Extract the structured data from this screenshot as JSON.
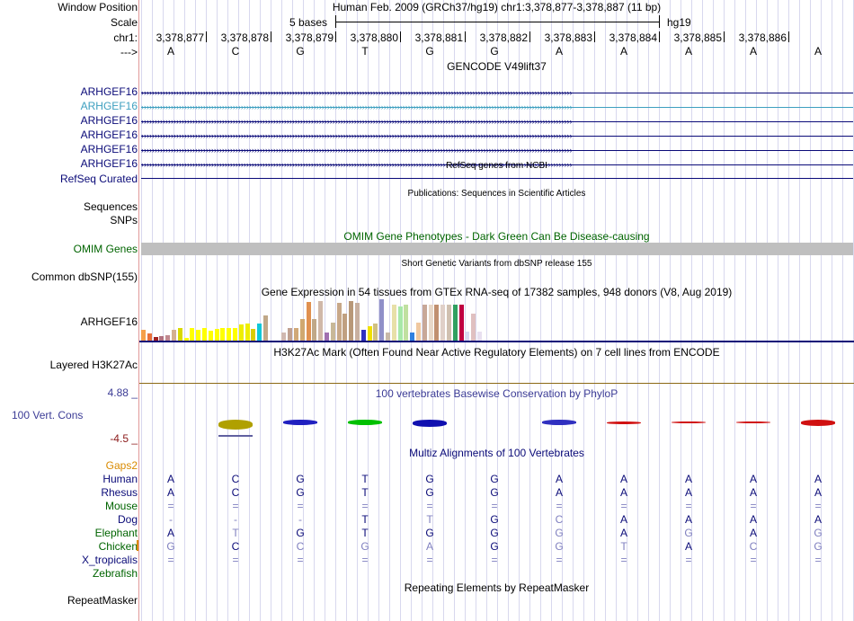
{
  "header": {
    "window_position_label": "Window Position",
    "scale_label": "Scale",
    "chrom_label": "chr1:",
    "arrow_label": "--->",
    "window_title": "Human Feb. 2009 (GRCh37/hg19)   chr1:3,378,877-3,378,887 (11 bp)",
    "scale_text": "5 bases",
    "assembly": "hg19",
    "positions": [
      "3,378,877",
      "3,378,878",
      "3,378,879",
      "3,378,880",
      "3,378,881",
      "3,378,882",
      "3,378,883",
      "3,378,884",
      "3,378,885",
      "3,378,886"
    ],
    "bases": [
      "A",
      "C",
      "G",
      "T",
      "G",
      "G",
      "A",
      "A",
      "A",
      "A",
      "A"
    ]
  },
  "tracks": {
    "gencode_title": "GENCODE V49lift37",
    "gencode_genes": [
      "ARHGEF16",
      "ARHGEF16",
      "ARHGEF16",
      "ARHGEF16",
      "ARHGEF16",
      "ARHGEF16"
    ],
    "refseq_title": "RefSeq genes from NCBI",
    "refseq_label": "RefSeq Curated",
    "publications_title": "Publications: Sequences in Scientific Articles",
    "sequences_label": "Sequences",
    "snps_label": "SNPs",
    "omim_title": "OMIM Gene Phenotypes - Dark Green Can Be Disease-causing",
    "omim_label": "OMIM Genes",
    "dbsnp_title": "Short Genetic Variants from dbSNP release 155",
    "dbsnp_label": "Common dbSNP(155)",
    "gtex_title": "Gene Expression in 54 tissues from GTEx RNA-seq of 17382 samples, 948 donors (V8, Aug 2019)",
    "gtex_label": "ARHGEF16",
    "h3k27_title": "H3K27Ac Mark (Often Found Near Active Regulatory Elements) on 7 cell lines from ENCODE",
    "h3k27_label": "Layered H3K27Ac",
    "cons_title": "100 vertebrates Basewise Conservation by PhyloP",
    "cons_label": "100 Vert. Cons",
    "cons_max": "4.88 _",
    "cons_min": "-4.5 _",
    "multiz_title": "Multiz Alignments of 100 Vertebrates",
    "gaps_label": "Gaps2",
    "repeat_title": "Repeating Elements by RepeatMasker",
    "repeat_label": "RepeatMasker"
  },
  "alignment": [
    {
      "species": "Human",
      "bases": [
        "A",
        "C",
        "G",
        "T",
        "G",
        "G",
        "A",
        "A",
        "A",
        "A",
        "A"
      ]
    },
    {
      "species": "Rhesus",
      "bases": [
        "A",
        "C",
        "G",
        "T",
        "G",
        "G",
        "A",
        "A",
        "A",
        "A",
        "A"
      ]
    },
    {
      "species": "Mouse",
      "bases": [
        "=",
        "=",
        "=",
        "=",
        "=",
        "=",
        "=",
        "=",
        "=",
        "=",
        "="
      ]
    },
    {
      "species": "Dog",
      "bases": [
        "-",
        "-",
        "-",
        "T",
        "T",
        "G",
        "C",
        "A",
        "A",
        "A",
        "A"
      ]
    },
    {
      "species": "Elephant",
      "bases": [
        "A",
        "T",
        "G",
        "T",
        "G",
        "G",
        "G",
        "A",
        "G",
        "A",
        "G"
      ]
    },
    {
      "species": "Chicken",
      "bases": [
        "G",
        "C",
        "C",
        "G",
        "A",
        "G",
        "G",
        "T",
        "A",
        "C",
        "G"
      ]
    },
    {
      "species": "X_tropicalis",
      "bases": [
        "=",
        "=",
        "=",
        "=",
        "=",
        "=",
        "=",
        "=",
        "=",
        "=",
        "="
      ]
    },
    {
      "species": "Zebrafish",
      "bases": [
        "",
        "",
        "",
        "",
        "",
        "",
        "",
        "",
        "",
        "",
        ""
      ]
    }
  ],
  "gtex_values": [
    12,
    8,
    4,
    5,
    6,
    12,
    14,
    3,
    14,
    12,
    14,
    11,
    13,
    14,
    14,
    14,
    18,
    19,
    13,
    19,
    28,
    0,
    0,
    9,
    14,
    14,
    24,
    43,
    24,
    44,
    9,
    20,
    42,
    30,
    44,
    42,
    12,
    16,
    19,
    46,
    9,
    40,
    38,
    40,
    9,
    20,
    40,
    40,
    40,
    40,
    40,
    40,
    40,
    10,
    30,
    10
  ],
  "colors": {
    "gene_blue": "#0a0a78",
    "gene_light": "#3d9fbf",
    "omim_green": "#006400",
    "gtex_line": "#0a0a78",
    "h3k_line": "#8b6914",
    "cons_blue": "#3c3c96",
    "cons_red": "#8b1a1a",
    "gaps_orange": "#d98a00",
    "divider": "#e29a9a"
  }
}
